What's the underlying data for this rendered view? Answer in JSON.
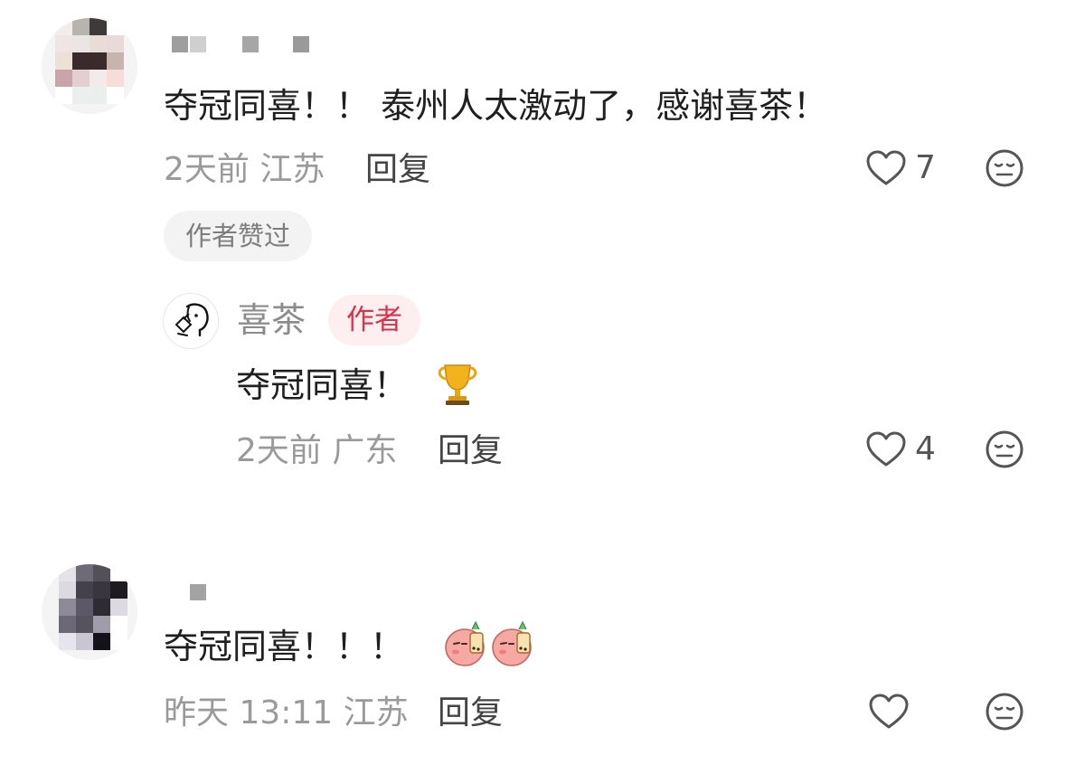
{
  "comments": [
    {
      "username_masked": true,
      "text": "夺冠同喜！！ 泰州人太激动了，感谢喜茶！",
      "time": "2天前",
      "location": "江苏",
      "reply_label": "回复",
      "like_count": "7",
      "liked_by_author_label": "作者赞过",
      "replies": [
        {
          "username": "喜茶",
          "author_badge": "作者",
          "text": "夺冠同喜！",
          "emoji": "trophy-icon",
          "time": "2天前",
          "location": "广东",
          "reply_label": "回复",
          "like_count": "4"
        }
      ]
    },
    {
      "username_masked": true,
      "text": "夺冠同喜！！！",
      "emoji": "peach-boba-sticker-icon",
      "time": "昨天 13:11",
      "location": "江苏",
      "reply_label": "回复",
      "like_count": ""
    }
  ],
  "colors": {
    "meta_gray": "#9a9a9a",
    "author_badge_text": "#d7344b",
    "author_badge_bg": "#fdeef0",
    "liked_badge_bg": "#f3f3f3"
  }
}
